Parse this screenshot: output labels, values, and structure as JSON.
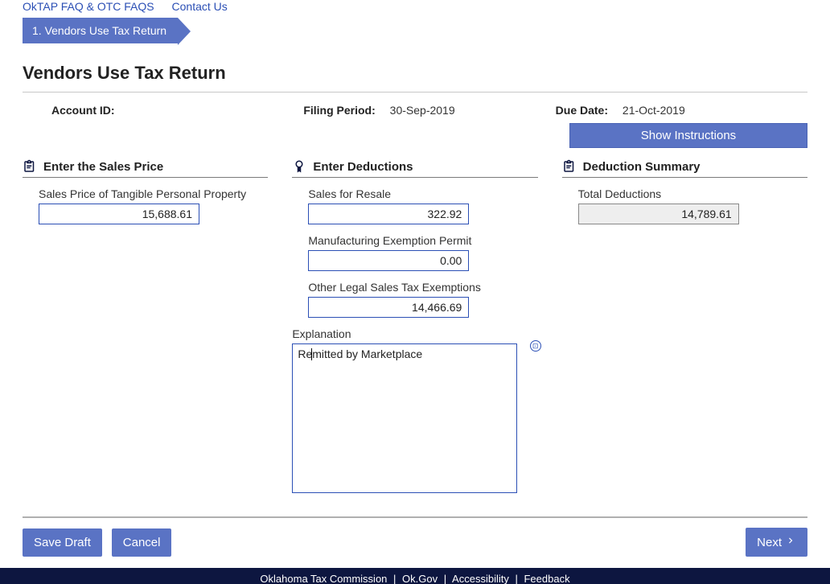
{
  "top_links": {
    "faq": "OkTAP FAQ & OTC FAQS",
    "contact": "Contact Us"
  },
  "breadcrumb": {
    "step1": "1. Vendors Use Tax Return"
  },
  "page_title": "Vendors Use Tax Return",
  "meta": {
    "account_id_label": "Account ID:",
    "account_id_value": "",
    "filing_period_label": "Filing Period:",
    "filing_period_value": "30-Sep-2019",
    "due_date_label": "Due Date:",
    "due_date_value": "21-Oct-2019"
  },
  "show_instructions_label": "Show Instructions",
  "sections": {
    "sales_price": {
      "title": "Enter the Sales Price",
      "field_label": "Sales Price of Tangible Personal Property",
      "value": "15,688.61"
    },
    "deductions": {
      "title": "Enter Deductions",
      "resale_label": "Sales for Resale",
      "resale_value": "322.92",
      "mfg_label": "Manufacturing Exemption Permit",
      "mfg_value": "0.00",
      "other_label": "Other Legal Sales Tax Exemptions",
      "other_value": "14,466.69",
      "explain_label": "Explanation",
      "explain_value": "Remitted by Marketplace"
    },
    "summary": {
      "title": "Deduction Summary",
      "total_label": "Total Deductions",
      "total_value": "14,789.61"
    }
  },
  "actions": {
    "save_draft": "Save Draft",
    "cancel": "Cancel",
    "next": "Next"
  },
  "footer": {
    "a": "Oklahoma Tax Commission",
    "b": "Ok.Gov",
    "c": "Accessibility",
    "d": "Feedback"
  }
}
